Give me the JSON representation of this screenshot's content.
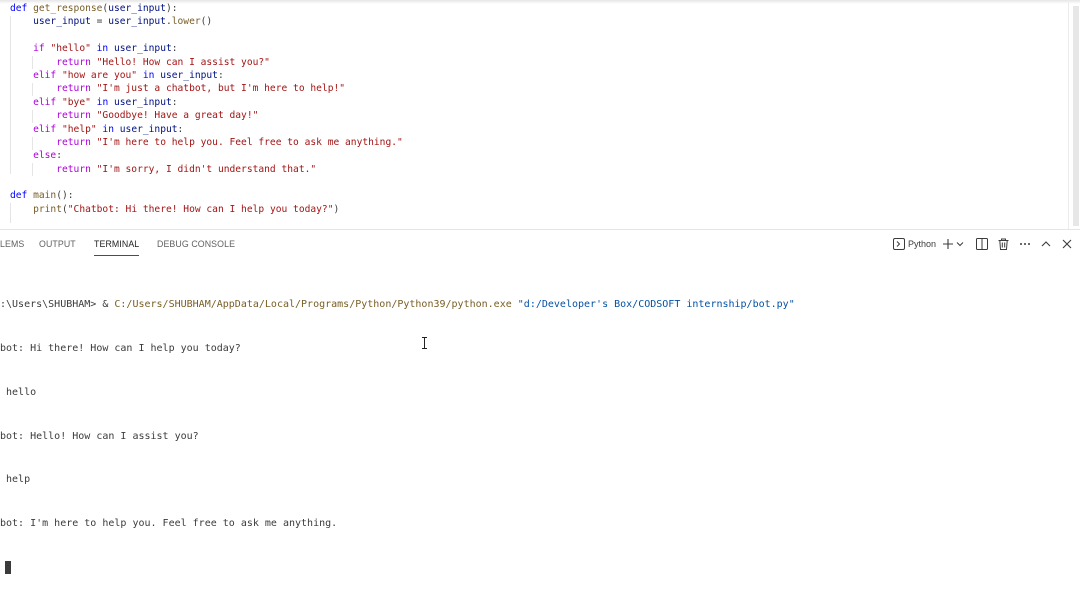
{
  "editor": {
    "code_lines": [
      [
        {
          "t": "def ",
          "c": "kw"
        },
        {
          "t": "get_response",
          "c": "fn"
        },
        {
          "t": "(",
          "c": "pln"
        },
        {
          "t": "user_input",
          "c": "var"
        },
        {
          "t": "):",
          "c": "pln"
        }
      ],
      [
        {
          "t": "    ",
          "c": "pln"
        },
        {
          "t": "user_input",
          "c": "var"
        },
        {
          "t": " = ",
          "c": "pln"
        },
        {
          "t": "user_input",
          "c": "var"
        },
        {
          "t": ".",
          "c": "pln"
        },
        {
          "t": "lower",
          "c": "fn"
        },
        {
          "t": "()",
          "c": "pln"
        }
      ],
      [],
      [
        {
          "t": "    ",
          "c": "pln"
        },
        {
          "t": "if ",
          "c": "ctl"
        },
        {
          "t": "\"hello\"",
          "c": "str"
        },
        {
          "t": " in ",
          "c": "kw"
        },
        {
          "t": "user_input",
          "c": "var"
        },
        {
          "t": ":",
          "c": "pln"
        }
      ],
      [
        {
          "t": "        ",
          "c": "pln"
        },
        {
          "t": "return ",
          "c": "ctl"
        },
        {
          "t": "\"Hello! How can I assist you?\"",
          "c": "str"
        }
      ],
      [
        {
          "t": "    ",
          "c": "pln"
        },
        {
          "t": "elif ",
          "c": "ctl"
        },
        {
          "t": "\"how are you\"",
          "c": "str"
        },
        {
          "t": " in ",
          "c": "kw"
        },
        {
          "t": "user_input",
          "c": "var"
        },
        {
          "t": ":",
          "c": "pln"
        }
      ],
      [
        {
          "t": "        ",
          "c": "pln"
        },
        {
          "t": "return ",
          "c": "ctl"
        },
        {
          "t": "\"I'm just a chatbot, but I'm here to help!\"",
          "c": "str"
        }
      ],
      [
        {
          "t": "    ",
          "c": "pln"
        },
        {
          "t": "elif ",
          "c": "ctl"
        },
        {
          "t": "\"bye\"",
          "c": "str"
        },
        {
          "t": " in ",
          "c": "kw"
        },
        {
          "t": "user_input",
          "c": "var"
        },
        {
          "t": ":",
          "c": "pln"
        }
      ],
      [
        {
          "t": "        ",
          "c": "pln"
        },
        {
          "t": "return ",
          "c": "ctl"
        },
        {
          "t": "\"Goodbye! Have a great day!\"",
          "c": "str"
        }
      ],
      [
        {
          "t": "    ",
          "c": "pln"
        },
        {
          "t": "elif ",
          "c": "ctl"
        },
        {
          "t": "\"help\"",
          "c": "str"
        },
        {
          "t": " in ",
          "c": "kw"
        },
        {
          "t": "user_input",
          "c": "var"
        },
        {
          "t": ":",
          "c": "pln"
        }
      ],
      [
        {
          "t": "        ",
          "c": "pln"
        },
        {
          "t": "return ",
          "c": "ctl"
        },
        {
          "t": "\"I'm here to help you. Feel free to ask me anything.\"",
          "c": "str"
        }
      ],
      [
        {
          "t": "    ",
          "c": "pln"
        },
        {
          "t": "else",
          "c": "ctl"
        },
        {
          "t": ":",
          "c": "pln"
        }
      ],
      [
        {
          "t": "        ",
          "c": "pln"
        },
        {
          "t": "return ",
          "c": "ctl"
        },
        {
          "t": "\"I'm sorry, I didn't understand that.\"",
          "c": "str"
        }
      ],
      [],
      [
        {
          "t": "def ",
          "c": "kw"
        },
        {
          "t": "main",
          "c": "fn"
        },
        {
          "t": "():",
          "c": "pln"
        }
      ],
      [
        {
          "t": "    ",
          "c": "pln"
        },
        {
          "t": "print",
          "c": "fn"
        },
        {
          "t": "(",
          "c": "pln"
        },
        {
          "t": "\"Chatbot: Hi there! How can I help you today?\"",
          "c": "str"
        },
        {
          "t": ")",
          "c": "pln"
        }
      ]
    ]
  },
  "panel": {
    "tabs": {
      "problems": "LEMS",
      "output": "OUTPUT",
      "terminal": "TERMINAL",
      "debug_console": "DEBUG CONSOLE"
    },
    "active_tab": "TERMINAL",
    "terminal_name": "Python",
    "action_icons": [
      "terminal-icon",
      "plus-icon",
      "chevron-down-icon",
      "split-icon",
      "trash-icon",
      "more-icon",
      "maximize-icon",
      "close-icon"
    ]
  },
  "terminal": {
    "prompt": ":\\Users\\SHUBHAM> & ",
    "command_exe": "C:/Users/SHUBHAM/AppData/Local/Programs/Python/Python39/python.exe",
    "command_arg": "\"d:/Developer's Box/CODSOFT internship/bot.py\"",
    "output_lines": [
      "bot: Hi there! How can I help you today?",
      " hello",
      "bot: Hello! How can I assist you?",
      " help",
      "bot: I'm here to help you. Feel free to ask me anything."
    ]
  },
  "colors": {
    "keyword": "#0000ff",
    "control": "#af00db",
    "function": "#795e26",
    "variable": "#001080",
    "string": "#a31515",
    "active_tab_underline": "#005fb8"
  }
}
